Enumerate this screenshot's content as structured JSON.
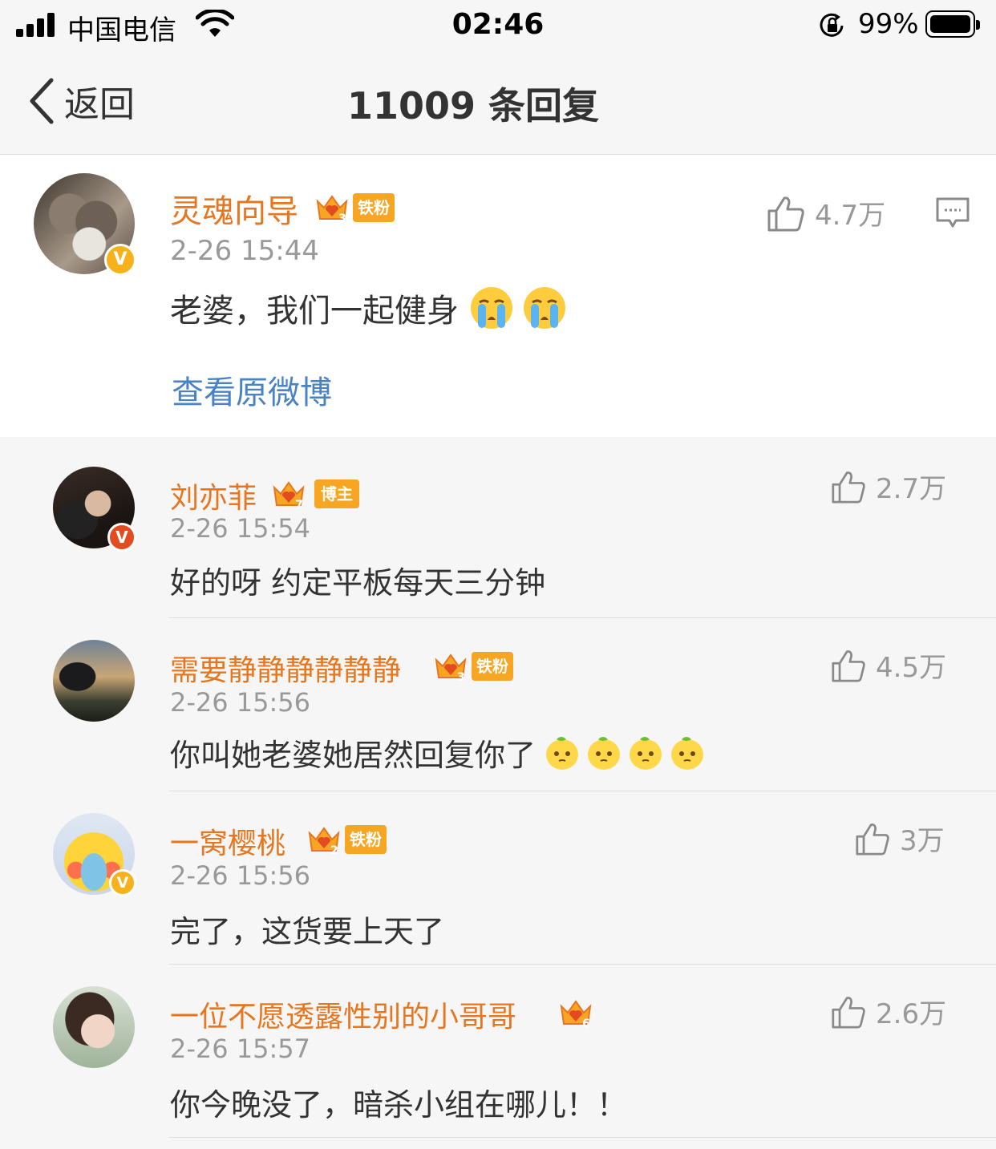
{
  "status_bar": {
    "carrier": "中国电信",
    "time": "02:46",
    "battery_pct": "99%"
  },
  "nav": {
    "back_label": "返回",
    "title": "11009 条回复"
  },
  "root": {
    "author": "灵魂向导",
    "crown_level": "3",
    "tag": "铁粉",
    "time": "2-26 15:44",
    "text": "老婆，我们一起健身",
    "emojis": [
      "crying-face",
      "crying-face"
    ],
    "likes": "4.7万",
    "view_original": "查看原微博"
  },
  "replies": [
    {
      "author": "刘亦菲",
      "crown_level": "7",
      "tag": "博主",
      "time": "2-26 15:54",
      "text": "好的呀 约定平板每天三分钟",
      "likes": "2.7万",
      "badge_color": "#e34b20"
    },
    {
      "author": "需要静静静静静静",
      "crown_level": "3",
      "tag": "铁粉",
      "time": "2-26 15:56",
      "text": "你叫她老婆她居然回复你了",
      "likes": "4.5万",
      "emojis": [
        "lemon-face",
        "lemon-face",
        "lemon-face",
        "lemon-face"
      ]
    },
    {
      "author": "一窝樱桃",
      "crown_level": "2",
      "tag": "铁粉",
      "time": "2-26 15:56",
      "text": "完了，这货要上天了",
      "likes": "3万",
      "badge_color": "#f7b21b"
    },
    {
      "author": "一位不愿透露性别的小哥哥",
      "crown_level": "6",
      "time": "2-26 15:57",
      "text": "你今晚没了，暗杀小组在哪儿！！",
      "likes": "2.6万"
    }
  ],
  "colors": {
    "username": "#e8761f",
    "link": "#4a83c4",
    "badge_orange": "#f6a623",
    "muted": "#999999"
  }
}
